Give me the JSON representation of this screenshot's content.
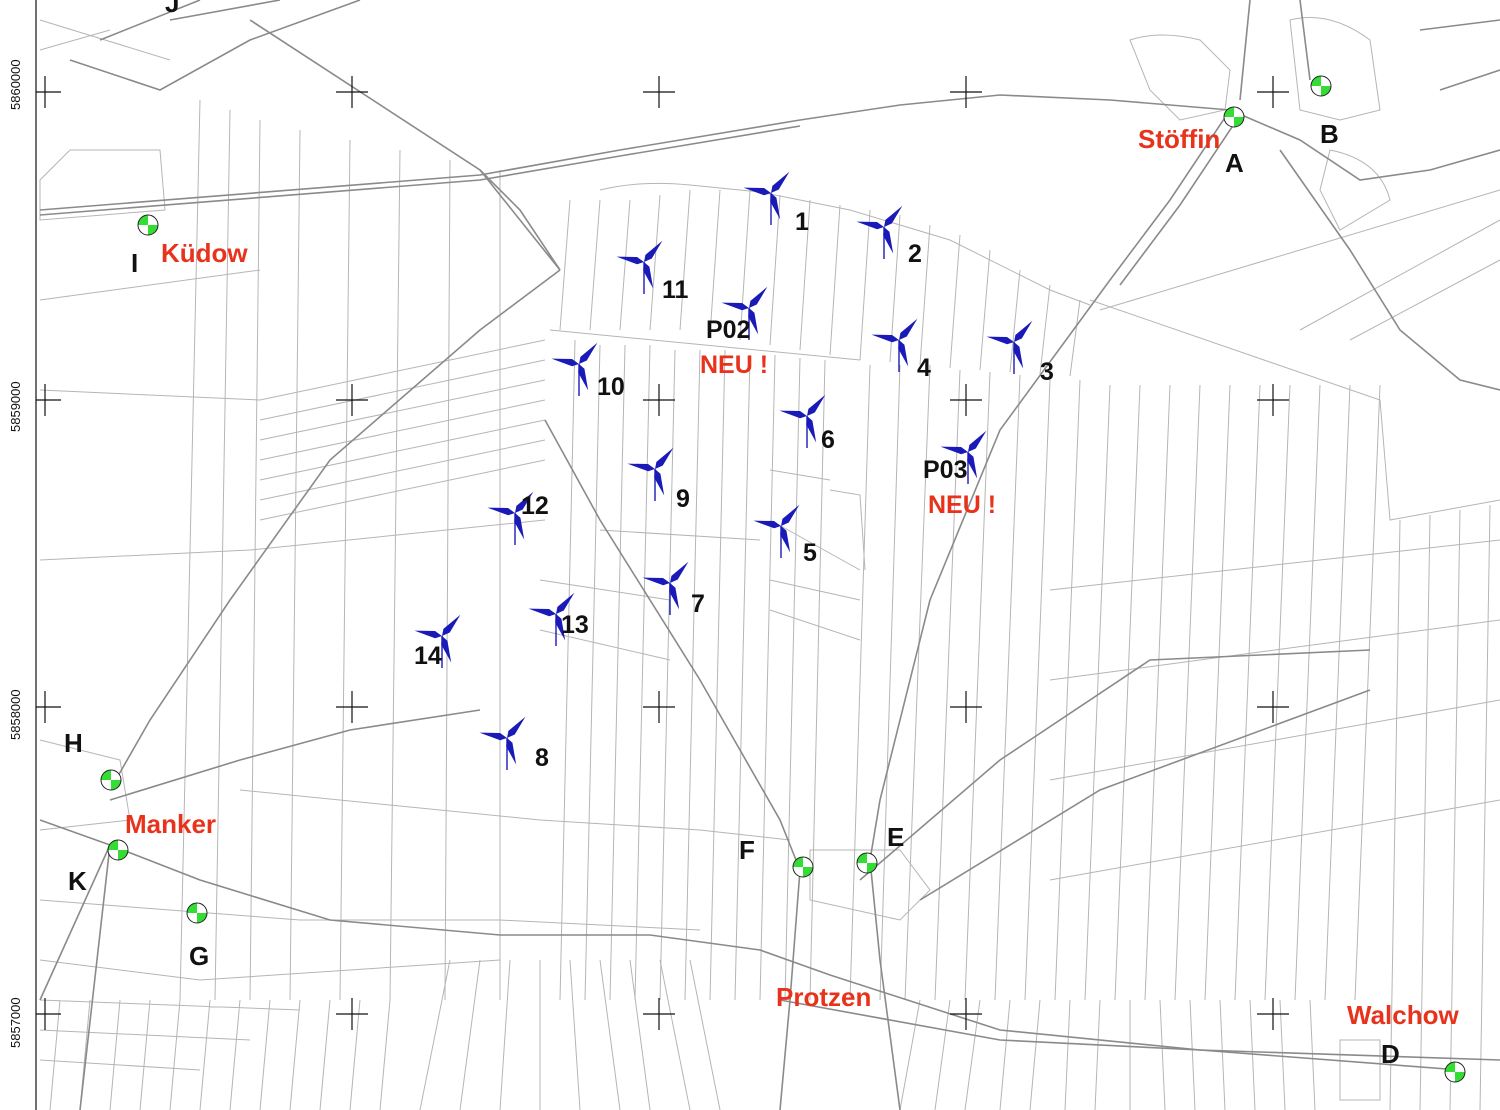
{
  "colors": {
    "background": "#ffffff",
    "parcel_lines": "#b5b5b5",
    "roads": "#8a8a8a",
    "turbine": "#1a1ab8",
    "town_label": "#e8331c",
    "marker_green": "#33dd33",
    "marker_white": "#ffffff"
  },
  "y_axis_labels": [
    "5860000",
    "5859000",
    "5858000",
    "5857000"
  ],
  "turbines": [
    {
      "id": "1",
      "label": "1"
    },
    {
      "id": "2",
      "label": "2"
    },
    {
      "id": "3",
      "label": "3"
    },
    {
      "id": "4",
      "label": "4"
    },
    {
      "id": "5",
      "label": "5"
    },
    {
      "id": "6",
      "label": "6"
    },
    {
      "id": "7",
      "label": "7"
    },
    {
      "id": "8",
      "label": "8"
    },
    {
      "id": "9",
      "label": "9"
    },
    {
      "id": "10",
      "label": "10"
    },
    {
      "id": "11",
      "label": "11"
    },
    {
      "id": "12",
      "label": "12"
    },
    {
      "id": "13",
      "label": "13"
    },
    {
      "id": "14",
      "label": "14"
    },
    {
      "id": "P02",
      "label": "P02",
      "note": "NEU !"
    },
    {
      "id": "P03",
      "label": "P03",
      "note": "NEU !"
    }
  ],
  "reference_points": [
    "A",
    "B",
    "D",
    "E",
    "F",
    "G",
    "H",
    "I",
    "J",
    "K"
  ],
  "towns": [
    "Stöffin",
    "Küdow",
    "Manker",
    "Protzen",
    "Walchow"
  ]
}
